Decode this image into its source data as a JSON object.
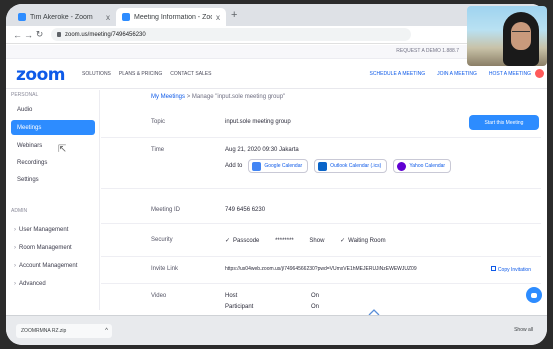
{
  "browser": {
    "tabs": [
      {
        "title": "Tim Akeroke - Zoom",
        "close": "x"
      },
      {
        "title": "Meeting Information - Zoom",
        "close": "x"
      }
    ],
    "new_tab": "+",
    "url": "zoom.us/meeting/7496456230"
  },
  "zoom": {
    "logo": "zoom",
    "request_demo": "REQUEST A DEMO    1.888.7",
    "nav_left": [
      "SOLUTIONS",
      "PLANS & PRICING",
      "CONTACT SALES"
    ],
    "nav_right": [
      "SCHEDULE A MEETING",
      "JOIN A MEETING",
      "HOST A MEETING"
    ]
  },
  "sidebar": {
    "personal_label": "PERSONAL",
    "items": [
      "Audio",
      "Meetings",
      "Webinars",
      "Recordings",
      "Settings"
    ],
    "admin_label": "ADMIN",
    "admin_items": [
      "User Management",
      "Room Management",
      "Account Management",
      "Advanced"
    ]
  },
  "main": {
    "breadcrumb_link": "My Meetings",
    "breadcrumb_sep": ">",
    "breadcrumb_current": "Manage \"input.sole meeting group\"",
    "start_button": "Start this Meeting",
    "topic_label": "Topic",
    "topic_value": "input.sole meeting group",
    "time_label": "Time",
    "time_value": "Aug 21, 2020 09:30 Jakarta",
    "add_to": "Add to",
    "calendars": [
      {
        "label": "Google Calendar",
        "color": "#4285f4"
      },
      {
        "label": "Outlook Calendar (.ics)",
        "color": "#0a64c8"
      },
      {
        "label": "Yahoo Calendar",
        "color": "#6001d2"
      }
    ],
    "meeting_id_label": "Meeting ID",
    "meeting_id_value": "749 6456 6230",
    "security_label": "Security",
    "passcode_label": "Passcode",
    "passcode_mask": "********",
    "passcode_show": "Show",
    "waiting_room_label": "Waiting Room",
    "invite_label": "Invite Link",
    "invite_value": "https://us04web.zoom.us/j/74964566230?pwd=VUmxVE1hMEJERUJiNzEWEWJUZ09",
    "copy_invitation": "Copy Invitation",
    "video_label": "Video",
    "host_label": "Host",
    "host_value": "On",
    "participant_label": "Participant",
    "participant_value": "On"
  },
  "downloads": {
    "item": "ZOOMRMNA RZ.zip",
    "caret": "^",
    "show_all": "Show all"
  }
}
